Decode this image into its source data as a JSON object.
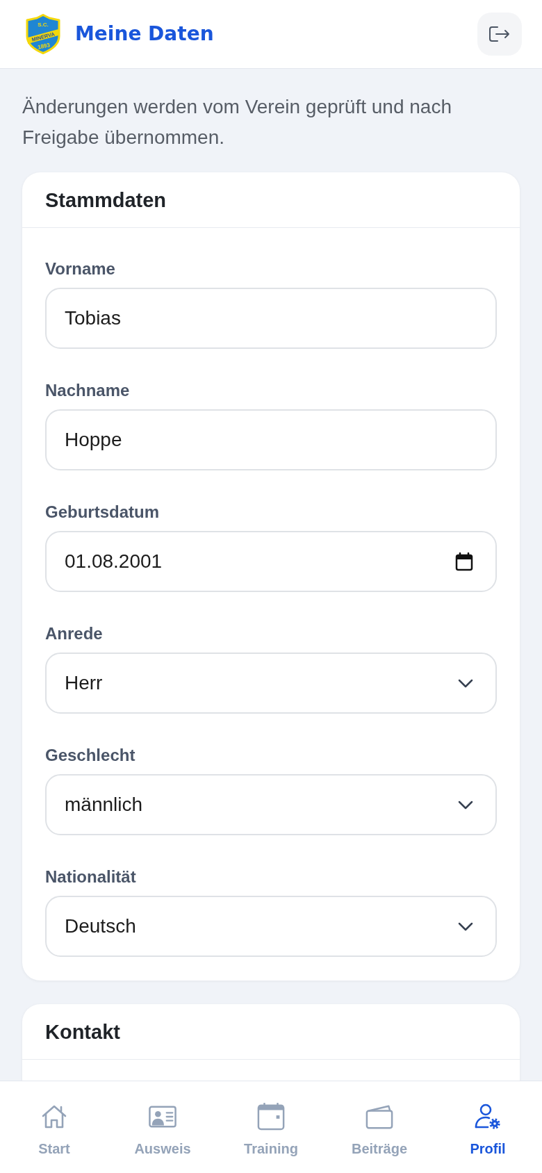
{
  "header": {
    "title": "Meine Daten",
    "logo_text": [
      "S.C.",
      "MINERVA",
      "1893"
    ]
  },
  "intro": "Änderungen werden vom Verein geprüft und nach Freigabe übernommen.",
  "sections": [
    {
      "title": "Stammdaten",
      "fields": [
        {
          "label": "Vorname",
          "kind": "text",
          "value": "Tobias"
        },
        {
          "label": "Nachname",
          "kind": "text",
          "value": "Hoppe"
        },
        {
          "label": "Geburtsdatum",
          "kind": "date",
          "value": "01.08.2001"
        },
        {
          "label": "Anrede",
          "kind": "select",
          "value": "Herr"
        },
        {
          "label": "Geschlecht",
          "kind": "select",
          "value": "männlich"
        },
        {
          "label": "Nationalität",
          "kind": "select",
          "value": "Deutsch"
        }
      ]
    },
    {
      "title": "Kontakt"
    }
  ],
  "nav": [
    {
      "label": "Start",
      "selected": false
    },
    {
      "label": "Ausweis",
      "selected": false
    },
    {
      "label": "Training",
      "selected": false
    },
    {
      "label": "Beiträge",
      "selected": false
    },
    {
      "label": "Profil",
      "selected": true
    }
  ]
}
